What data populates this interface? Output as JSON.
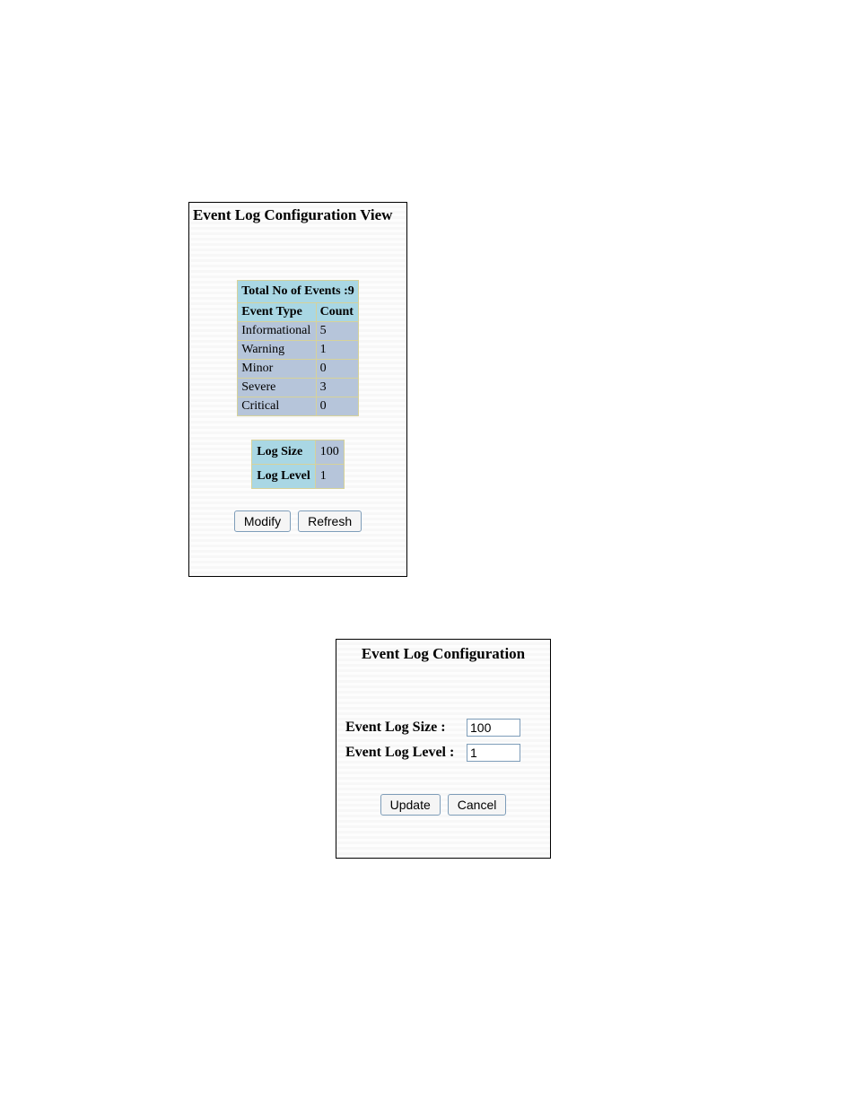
{
  "view": {
    "title": "Event Log Configuration View",
    "total_label": "Total No of Events :",
    "total_value": "9",
    "headers": {
      "type": "Event Type",
      "count": "Count"
    },
    "rows": [
      {
        "type": "Informational",
        "count": "5"
      },
      {
        "type": "Warning",
        "count": "1"
      },
      {
        "type": "Minor",
        "count": "0"
      },
      {
        "type": "Severe",
        "count": "3"
      },
      {
        "type": "Critical",
        "count": "0"
      }
    ],
    "log_size_label": "Log Size",
    "log_size_value": "100",
    "log_level_label": "Log Level",
    "log_level_value": "1",
    "modify_label": "Modify",
    "refresh_label": "Refresh"
  },
  "config": {
    "title": "Event Log Configuration",
    "size_label": "Event Log Size   :",
    "size_value": "100",
    "level_label": "Event Log Level :",
    "level_value": "1",
    "update_label": "Update",
    "cancel_label": "Cancel"
  }
}
